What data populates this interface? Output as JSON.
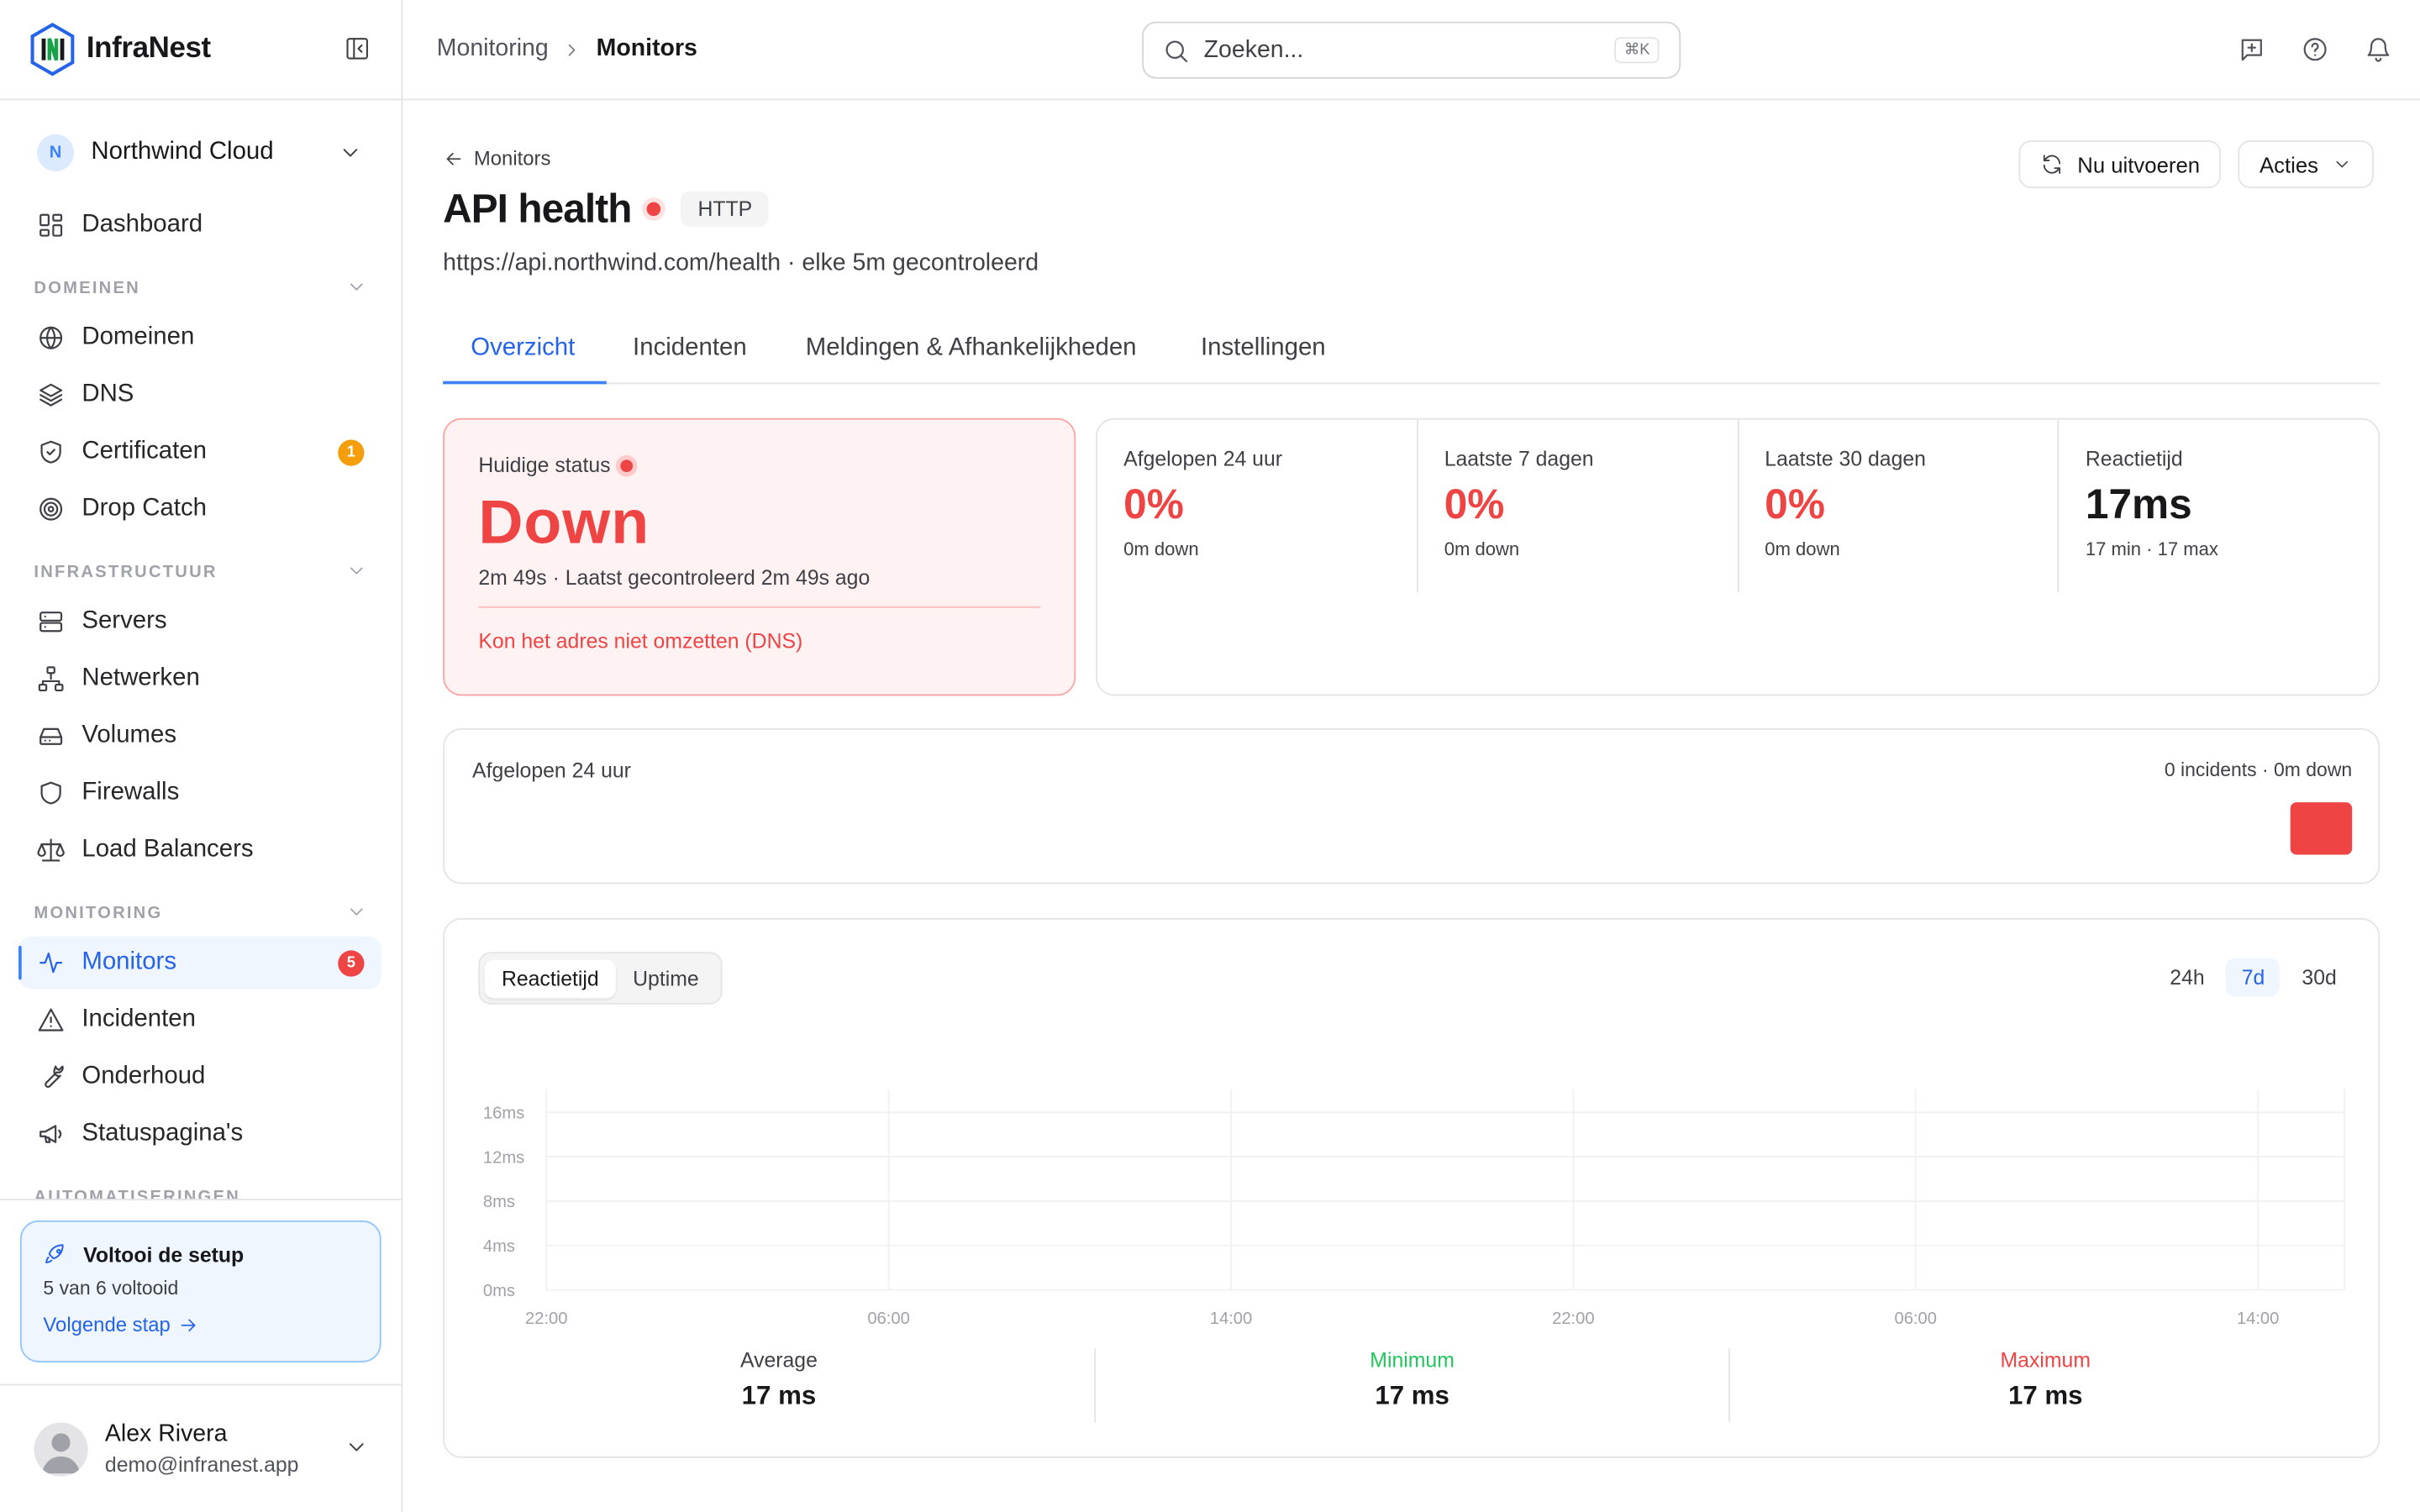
{
  "brand": {
    "name": "InfraNest"
  },
  "org": {
    "initial": "N",
    "name": "Northwind Cloud"
  },
  "nav": {
    "dashboard": "Dashboard",
    "sections": {
      "domains": "DOMEINEN",
      "infra": "INFRASTRUCTUUR",
      "monitoring": "MONITORING",
      "automation": "AUTOMATISERINGEN"
    },
    "domains": [
      "Domeinen",
      "DNS",
      "Certificaten",
      "Drop Catch"
    ],
    "infra": [
      "Servers",
      "Netwerken",
      "Volumes",
      "Firewalls",
      "Load Balancers"
    ],
    "monitoring": [
      "Monitors",
      "Incidenten",
      "Onderhoud",
      "Statuspagina's"
    ],
    "badges": {
      "certificates": "1",
      "monitors": "5"
    }
  },
  "setup": {
    "title": "Voltooi de setup",
    "progress": "5 van 6 voltooid",
    "next": "Volgende stap"
  },
  "user": {
    "name": "Alex Rivera",
    "email": "demo@infranest.app"
  },
  "breadcrumb": {
    "parent": "Monitoring",
    "current": "Monitors"
  },
  "search": {
    "placeholder": "Zoeken...",
    "shortcut": "⌘K"
  },
  "monitor": {
    "back": "Monitors",
    "name": "API health",
    "type": "HTTP",
    "subtitle": "https://api.northwind.com/health · elke 5m gecontroleerd",
    "run_now": "Nu uitvoeren",
    "actions": "Acties"
  },
  "tabs": [
    "Overzicht",
    "Incidenten",
    "Meldingen & Afhankelijkheden",
    "Instellingen"
  ],
  "status": {
    "label": "Huidige status",
    "value": "Down",
    "detail": "2m 49s · Laatst gecontroleerd 2m 49s ago",
    "error": "Kon het adres niet omzetten (DNS)"
  },
  "stats": [
    {
      "label": "Afgelopen 24 uur",
      "value": "0%",
      "sub": "0m down"
    },
    {
      "label": "Laatste 7 dagen",
      "value": "0%",
      "sub": "0m down"
    },
    {
      "label": "Laatste 30 dagen",
      "value": "0%",
      "sub": "0m down"
    },
    {
      "label": "Reactietijd",
      "value": "17ms",
      "sub": "17 min · 17 max"
    }
  ],
  "last24": {
    "label": "Afgelopen 24 uur",
    "summary": "0 incidents · 0m down"
  },
  "chart_toggle": {
    "options": [
      "Reactietijd",
      "Uptime"
    ],
    "selected": "Reactietijd"
  },
  "ranges": {
    "options": [
      "24h",
      "7d",
      "30d"
    ],
    "selected": "7d"
  },
  "chart_data": {
    "type": "line",
    "y_ticks": [
      "16ms",
      "12ms",
      "8ms",
      "4ms",
      "0ms"
    ],
    "x_ticks": [
      "22:00",
      "06:00",
      "14:00",
      "22:00",
      "06:00",
      "14:00"
    ],
    "ylim": [
      0,
      16
    ],
    "series": []
  },
  "summary": [
    {
      "label": "Average",
      "value": "17 ms"
    },
    {
      "label": "Minimum",
      "value": "17 ms"
    },
    {
      "label": "Maximum",
      "value": "17 ms"
    }
  ],
  "colors": {
    "accent": "#2563eb",
    "danger": "#ef4444",
    "success": "#22c55e"
  }
}
